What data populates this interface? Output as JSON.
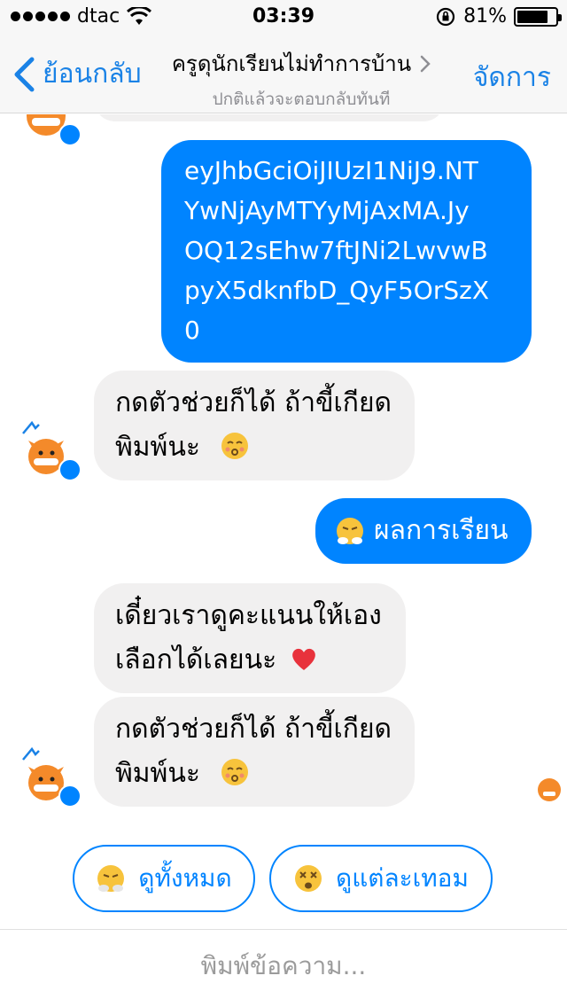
{
  "status_bar": {
    "carrier": "dtac",
    "time": "03:39",
    "battery_percent": "81%",
    "battery_level": 0.81
  },
  "nav": {
    "back_label": "ย้อนกลับ",
    "title": "ครูดุนักเรียนไม่ทำการบ้าน",
    "subtitle": "ปกติแล้วจะตอบกลับทันที",
    "manage_label": "จัดการ"
  },
  "messages": [
    {
      "from": "me",
      "lines": [
        "eyJhbGciOiJIUzI1NiJ9.NT",
        "YwNjAyMTYyMjAxMA.Jy",
        "OQ12sEhw7ftJNi2LwvwB",
        "pyX5dknfbD_QyF5OrSzX",
        "0"
      ]
    },
    {
      "from": "bot",
      "lines": [
        "กดตัวช่วยก็ได้ ถ้าขี้เกียด",
        "พิมพ์นะ"
      ],
      "emoji": "kissing-face"
    },
    {
      "from": "me",
      "text": "ผลการเรียน",
      "emoji": "steam-face"
    },
    {
      "from": "bot",
      "lines": [
        "เดี๋ยวเราดูคะแนนให้เอง",
        "เลือกได้เลยนะ"
      ],
      "emoji": "red-heart"
    },
    {
      "from": "bot",
      "lines": [
        "กดตัวช่วยก็ได้ ถ้าขี้เกียด",
        "พิมพ์นะ"
      ],
      "emoji": "kissing-face"
    }
  ],
  "quick_replies": [
    {
      "label": "ดูทั้งหมด",
      "emoji": "steam-face"
    },
    {
      "label": "ดูแต่ละเทอม",
      "emoji": "dizzy-face"
    }
  ],
  "composer": {
    "placeholder": "พิมพ์ข้อความ..."
  },
  "colors": {
    "accent": "#0084ff",
    "nav_blue": "#1a82e6",
    "incoming_bubble": "#f1f0f0"
  }
}
